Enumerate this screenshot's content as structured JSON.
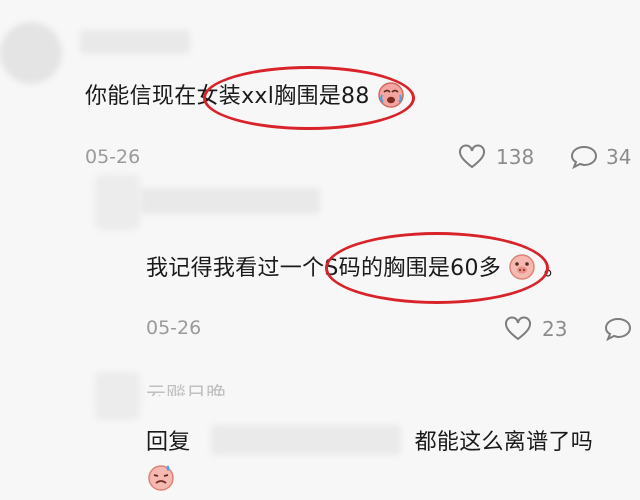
{
  "comments": [
    {
      "text": "你能信现在女装xxl胸围是88",
      "date": "05-26",
      "likes": "138",
      "replies": "34"
    },
    {
      "text": "我记得我看过一个S码的胸围是60多",
      "trail": "。",
      "date": "05-26",
      "likes": "23"
    },
    {
      "partial_username": "云飚日晚",
      "reply_label": "回复",
      "reply_text": "都能这么离谱了吗"
    }
  ],
  "icons": {
    "emoji_1": "crying-laughing-emoji",
    "emoji_2": "pig-face-emoji",
    "emoji_3": "sweating-emoji",
    "like": "heart-outline-icon",
    "reply": "speech-bubble-icon"
  },
  "colors": {
    "highlight": "#d8232a",
    "meta_gray": "#9a9a9a",
    "background": "#f7f7f7"
  }
}
